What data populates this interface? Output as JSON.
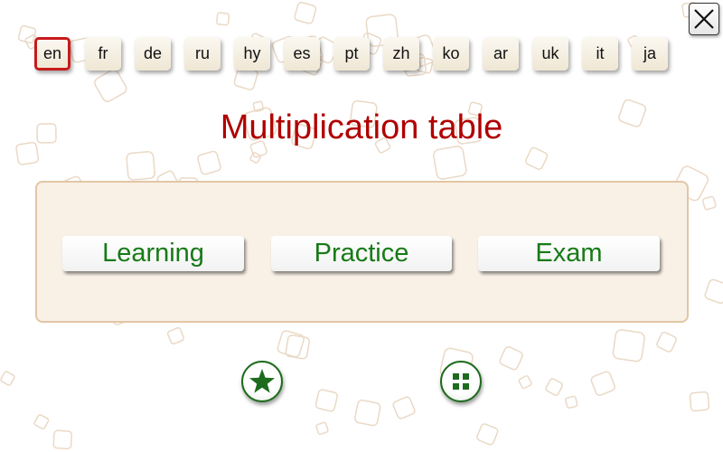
{
  "languages": [
    {
      "code": "en",
      "selected": true
    },
    {
      "code": "fr",
      "selected": false
    },
    {
      "code": "de",
      "selected": false
    },
    {
      "code": "ru",
      "selected": false
    },
    {
      "code": "hy",
      "selected": false
    },
    {
      "code": "es",
      "selected": false
    },
    {
      "code": "pt",
      "selected": false
    },
    {
      "code": "zh",
      "selected": false
    },
    {
      "code": "ko",
      "selected": false
    },
    {
      "code": "ar",
      "selected": false
    },
    {
      "code": "uk",
      "selected": false
    },
    {
      "code": "it",
      "selected": false
    },
    {
      "code": "ja",
      "selected": false
    }
  ],
  "title": "Multiplication table",
  "modes": {
    "learning": "Learning",
    "practice": "Practice",
    "exam": "Exam"
  },
  "icons": {
    "close": "close-icon",
    "favorites": "star-icon",
    "more_apps": "grid-icon"
  },
  "colors": {
    "title": "#b00000",
    "mode_text": "#177a17",
    "selected_border": "#c81a1a",
    "panel_bg": "#f9f0e6",
    "panel_border": "#e2c6a6",
    "icon_green": "#1d6b1d"
  }
}
